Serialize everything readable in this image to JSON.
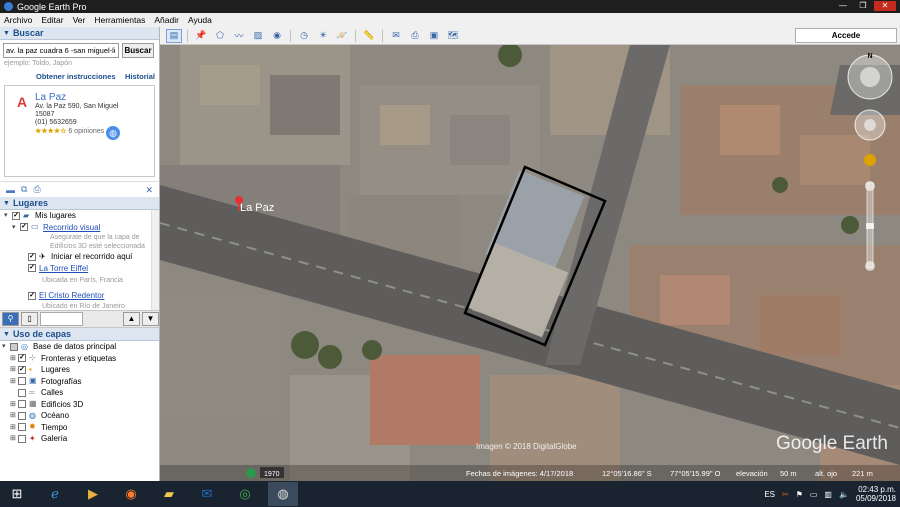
{
  "window": {
    "title": "Google Earth Pro"
  },
  "menu": [
    "Archivo",
    "Editar",
    "Ver",
    "Herramientas",
    "Añadir",
    "Ayuda"
  ],
  "toolbar": {
    "accede_label": "Accede"
  },
  "search": {
    "header": "Buscar",
    "value": "av. la paz cuadra 6 -san miguel-lima",
    "button": "Buscar",
    "hint": "ejemplo: Toldo, Japón",
    "link_directions": "Obtener instrucciones",
    "link_history": "Historial",
    "result": {
      "marker": "A",
      "name": "La Paz",
      "address1": "Av. la Paz 590, San Miguel",
      "address2": "15087",
      "phone": "(01) 5632659",
      "stars": "★★★★☆",
      "reviews": "6 opiniones"
    }
  },
  "places": {
    "header": "Lugares",
    "items": [
      {
        "label": "Mis lugares"
      },
      {
        "label": "Recorrido visual",
        "sub1": "Asegúrate de que la capa de",
        "sub2": "Edificios 3D esté seleccionada"
      },
      {
        "label": "Iniciar el recorrido aquí"
      },
      {
        "label": "La Torre Eiffel",
        "sub1": "Ubicada en París, Francia"
      },
      {
        "label": "El Cristo Redentor",
        "sub1": "Ubicado en Río de Janeiro"
      }
    ]
  },
  "layers": {
    "header": "Uso de capas",
    "items": [
      {
        "label": "Base de datos principal"
      },
      {
        "label": "Fronteras y etiquetas"
      },
      {
        "label": "Lugares"
      },
      {
        "label": "Fotografías"
      },
      {
        "label": "Calles"
      },
      {
        "label": "Edificios 3D"
      },
      {
        "label": "Océano"
      },
      {
        "label": "Tiempo"
      },
      {
        "label": "Galería"
      }
    ]
  },
  "map": {
    "place_label": "La Paz",
    "watermark": "Google Earth",
    "copyright": "Imagen © 2018 DigitalGlobe",
    "year": "1970",
    "status": {
      "date": "Fechas de imágenes: 4/17/2018",
      "lat": "12°05'16.86\" S",
      "lon": "77°05'15.99\" O",
      "elev_label": "elevación",
      "elev_value": "50 m",
      "eye_label": "alt. ojo",
      "eye_value": "221 m"
    },
    "compass_n": "N"
  },
  "taskbar": {
    "lang": "ES",
    "time": "02:43 p.m.",
    "date": "05/09/2018"
  }
}
